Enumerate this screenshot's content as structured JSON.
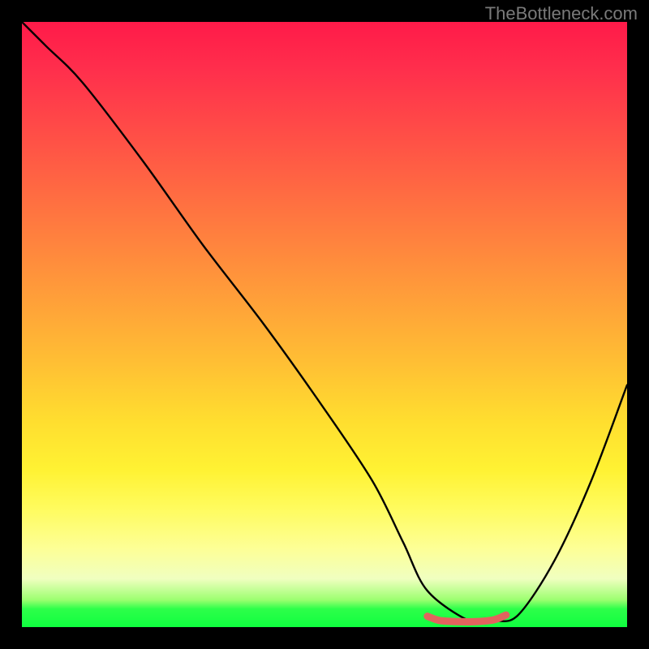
{
  "watermark": "TheBottleneck.com",
  "chart_data": {
    "type": "line",
    "title": "",
    "xlabel": "",
    "ylabel": "",
    "xlim": [
      0,
      100
    ],
    "ylim": [
      0,
      100
    ],
    "grid": false,
    "legend": false,
    "series": [
      {
        "name": "black-curve",
        "color": "#000000",
        "x": [
          0,
          4,
          10,
          20,
          30,
          40,
          50,
          58,
          63,
          67,
          74,
          78,
          82,
          88,
          94,
          100
        ],
        "y": [
          100,
          96,
          90,
          77,
          63,
          50,
          36,
          24,
          14,
          6,
          1,
          1,
          2,
          11,
          24,
          40
        ]
      },
      {
        "name": "red-valley-marker",
        "color": "#e2635e",
        "x": [
          67,
          69,
          72,
          75,
          78,
          80
        ],
        "y": [
          1.8,
          1.1,
          0.9,
          0.9,
          1.2,
          2.0
        ]
      }
    ],
    "gradient_stops": [
      {
        "pos": 0,
        "color": "#ff1a49"
      },
      {
        "pos": 0.2,
        "color": "#ff5246"
      },
      {
        "pos": 0.44,
        "color": "#ff9a3a"
      },
      {
        "pos": 0.66,
        "color": "#ffde2f"
      },
      {
        "pos": 0.87,
        "color": "#fdff96"
      },
      {
        "pos": 0.97,
        "color": "#2dff4a"
      },
      {
        "pos": 1.0,
        "color": "#0fff3f"
      }
    ]
  }
}
